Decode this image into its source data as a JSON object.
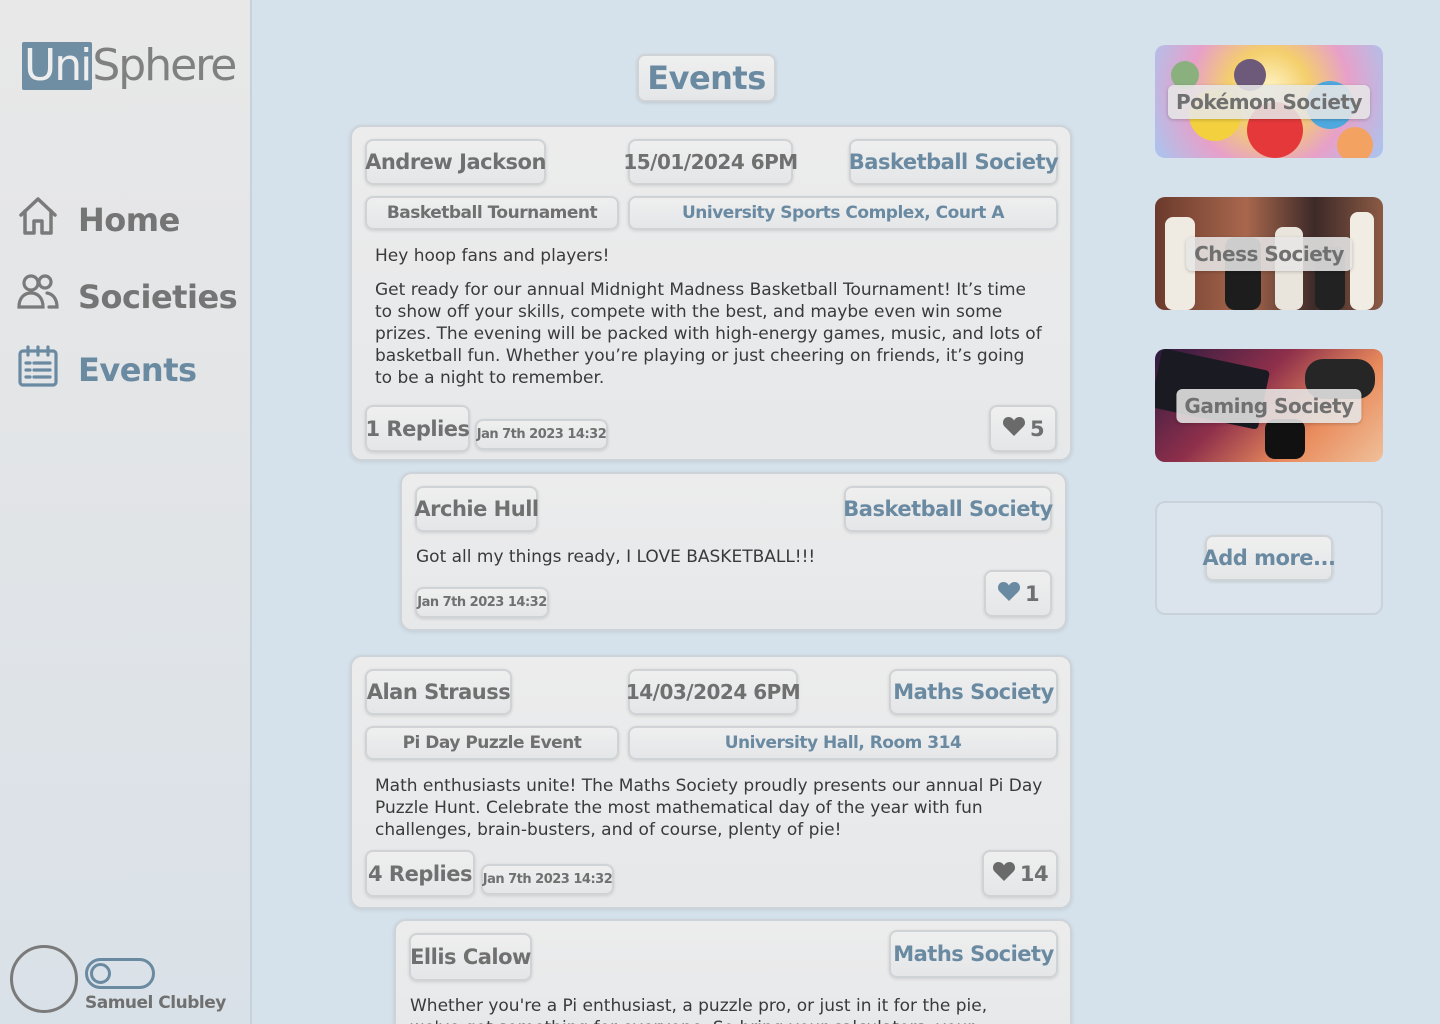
{
  "app": {
    "logo_uni": "Uni",
    "logo_sphere": "Sphere"
  },
  "nav": {
    "home": "Home",
    "societies": "Societies",
    "events": "Events",
    "active": "events"
  },
  "user": {
    "name": "Samuel Clubley"
  },
  "page": {
    "title": "Events"
  },
  "posts": [
    {
      "author": "Andrew Jackson",
      "date": "15/01/2024 6PM",
      "society": "Basketball Society",
      "event": "Basketball Tournament",
      "location": "University Sports Complex, Court A",
      "body_p1": "Hey hoop fans and players!",
      "body_p2": "Get ready for our annual Midnight Madness Basketball Tournament! It’s time to show off your skills, compete with the best, and maybe even win some prizes. The evening will be packed with high-energy games, music, and lots of basketball fun. Whether you’re playing or just cheering on friends, it’s going to be a night to remember.",
      "replies": "1 Replies",
      "timestamp": "Jan 7th 2023 14:32",
      "likes": "5"
    },
    {
      "author": "Alan Strauss",
      "date": "14/03/2024 6PM",
      "society": "Maths Society",
      "event": "Pi Day Puzzle Event",
      "location": "University Hall, Room 314",
      "body_p1": "Math enthusiasts unite! The Maths Society proudly presents our annual Pi Day Puzzle Hunt. Celebrate the most mathematical day of the year with fun challenges, brain-busters, and of course, plenty of pie!",
      "replies": "4 Replies",
      "timestamp": "Jan 7th 2023 14:32",
      "likes": "14"
    }
  ],
  "replies": [
    {
      "author": "Archie Hull",
      "society": "Basketball Society",
      "body": "Got all my things ready, I LOVE BASKETBALL!!!",
      "timestamp": "Jan 7th 2023 14:32",
      "likes": "1"
    },
    {
      "author": "Ellis Calow",
      "society": "Maths Society",
      "body": "Whether you're a Pi enthusiast, a puzzle pro, or just in it for the pie, we've got something for everyone. So bring your calculators, your"
    }
  ],
  "societies": [
    {
      "name": "Pokémon Society",
      "image": "pokemon-image"
    },
    {
      "name": "Chess Society",
      "image": "chess-image"
    },
    {
      "name": "Gaming Society",
      "image": "gaming-image"
    }
  ],
  "add_more": "Add more...",
  "colors": {
    "accent": "#6a8aa2",
    "background": "#d5e2ec",
    "liked_heart": "#6a8aa2",
    "heart": "#6a6a6a"
  },
  "icons": [
    "home-icon",
    "societies-icon",
    "calendar-icon",
    "heart-icon"
  ]
}
